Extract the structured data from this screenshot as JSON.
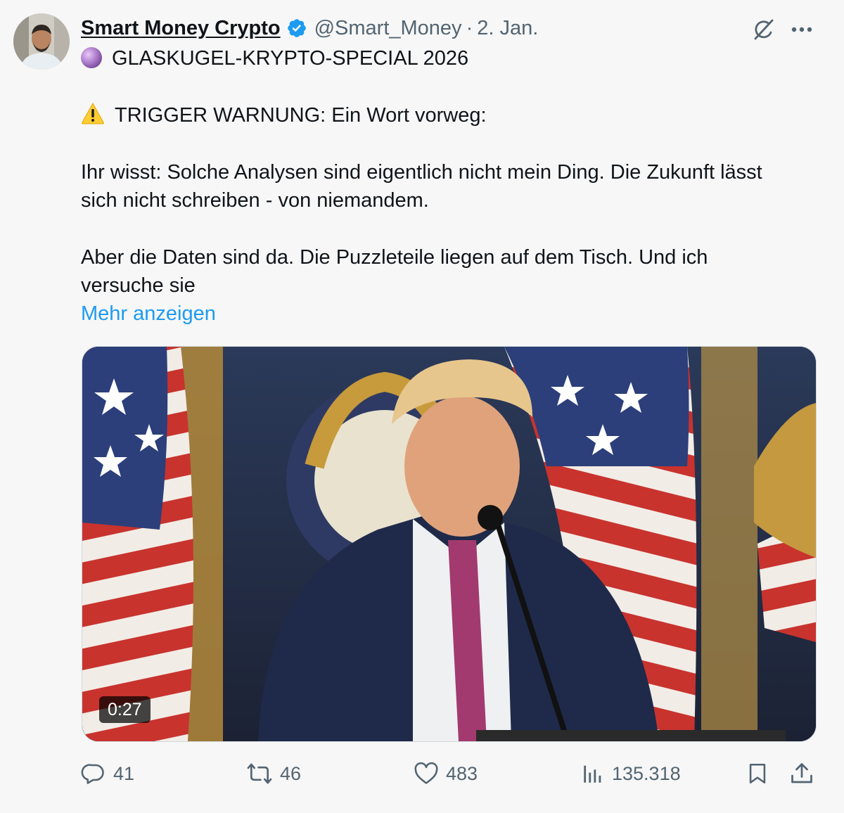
{
  "tweet": {
    "author_name": "Smart Money Crypto",
    "handle": "@Smart_Money",
    "separator": "·",
    "date": "2. Jan.",
    "lines": [
      "GLASKUGEL-KRYPTO-SPECIAL 2026",
      "TRIGGER WARNUNG: Ein Wort vorweg:",
      "Ihr wisst: Solche Analysen sind eigentlich nicht mein Ding. Die Zukunft lässt",
      "sich nicht schreiben - von niemandem.",
      "Aber die Daten sind da. Die Puzzleteile liegen auf dem Tisch. Und ich",
      "versuche sie"
    ],
    "show_more": "Mehr anzeigen",
    "video_duration": "0:27"
  },
  "actions": {
    "replies": "41",
    "reposts": "46",
    "likes": "483",
    "views": "135.318"
  },
  "icons": {
    "verified": "verified-badge-icon",
    "grok": "grok-icon",
    "more": "more-icon",
    "reply": "reply-icon",
    "repost": "repost-icon",
    "like": "heart-icon",
    "views": "views-icon",
    "bookmark": "bookmark-icon",
    "share": "share-icon"
  },
  "colors": {
    "accent": "#1d9bf0",
    "secondary_text": "#536471",
    "background": "#f7f7f7"
  }
}
